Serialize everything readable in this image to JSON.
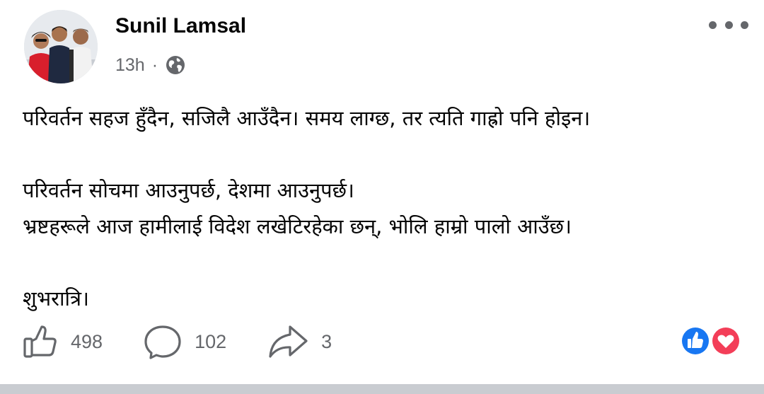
{
  "post": {
    "author": "Sunil Lamsal",
    "time": "13h",
    "separator": "·",
    "audience_icon": "globe-icon",
    "body": [
      "परिवर्तन सहज हुँदैन, सजिलै आउँदैन। समय लाग्छ, तर त्यति गाह्रो पनि होइन।",
      "",
      "परिवर्तन सोचमा आउनुपर्छ, देशमा आउनुपर्छ।",
      "भ्रष्टहरूले आज हामीलाई विदेश लखेटिरहेका छन्, भोलि हाम्रो पालो आउँछ।",
      "",
      "शुभरात्रि।"
    ]
  },
  "actions": {
    "like": {
      "icon": "thumbs-up-icon",
      "count": "498"
    },
    "comment": {
      "icon": "comment-icon",
      "count": "102"
    },
    "share": {
      "icon": "share-icon",
      "count": "3"
    }
  },
  "reactions": [
    "like-reaction-icon",
    "love-reaction-icon"
  ],
  "colors": {
    "like_blue": "#1877f2",
    "love_red": "#f33e58",
    "muted": "#65676b"
  }
}
